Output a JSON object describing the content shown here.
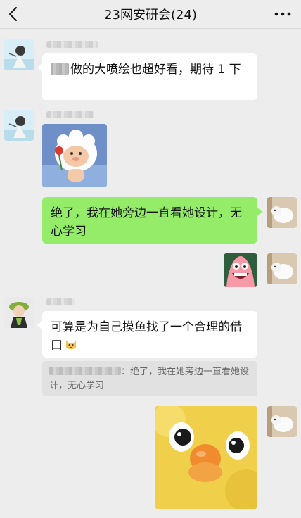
{
  "header": {
    "title": "23网安研会(24)",
    "back_icon": "chevron-left-icon",
    "more_icon": "more-dots-icon"
  },
  "messages": [
    {
      "sender": "other",
      "type": "text",
      "text": "做的大喷绘也超好看，期待 1 下"
    },
    {
      "sender": "other",
      "type": "sticker",
      "sticker": "sheep-with-rose"
    },
    {
      "sender": "me",
      "type": "text",
      "text": "绝了，我在她旁边一直看她设计，无心学习"
    },
    {
      "sender": "me",
      "type": "sticker",
      "sticker": "patrick-star-grin"
    },
    {
      "sender": "other",
      "type": "text",
      "text": "可算是为自己摸鱼找了一个合理的借口",
      "emoji": "cat-emoji",
      "quote": {
        "prefix": "：",
        "text": "绝了，我在她旁边一直看她设计，无心学习"
      }
    },
    {
      "sender": "me",
      "type": "sticker",
      "sticker": "yellow-chick-face"
    }
  ],
  "colors": {
    "background": "#ededed",
    "bubble_me": "#95ec69",
    "bubble_other": "#ffffff"
  }
}
